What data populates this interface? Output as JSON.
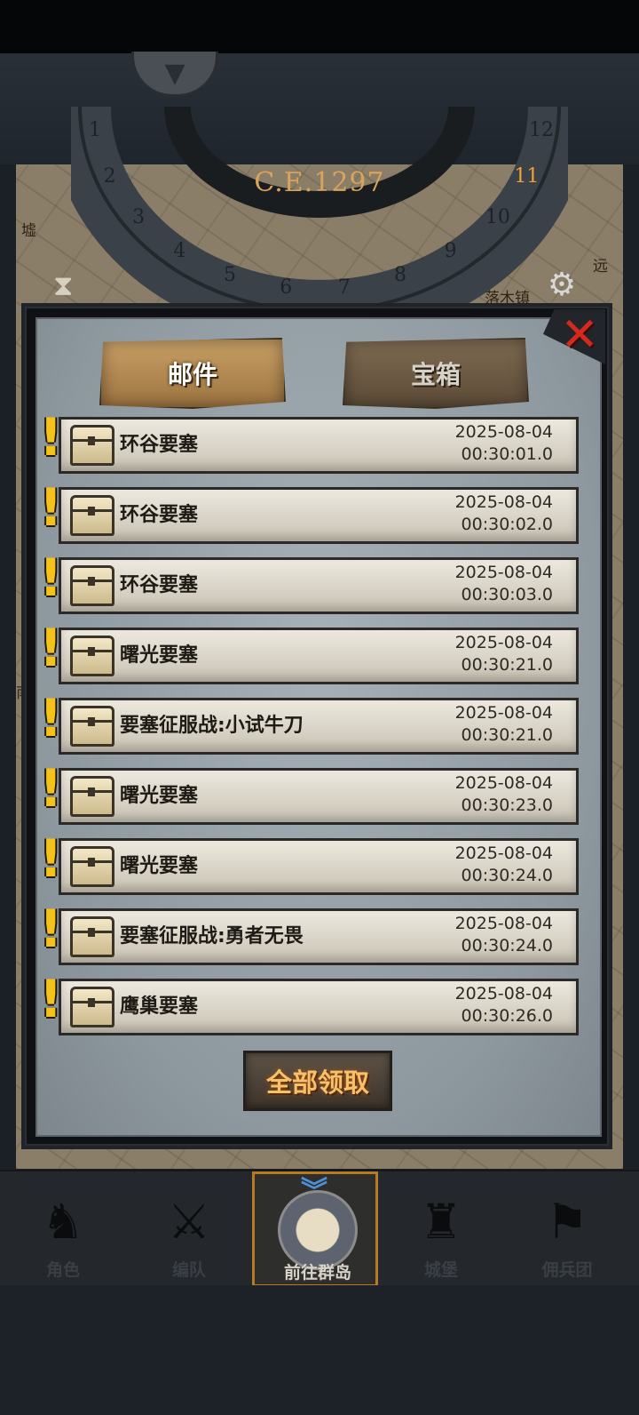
{
  "hud": {
    "era": "C.E.1297"
  },
  "map": {
    "labels": [
      "墟",
      "远",
      "落木镇",
      "南"
    ],
    "ring_numbers": [
      "1",
      "2",
      "3",
      "4",
      "5",
      "6",
      "7",
      "8",
      "9",
      "10",
      "11",
      "12"
    ],
    "highlight_number": "11"
  },
  "tabs": {
    "mail": "邮件",
    "chest": "宝箱",
    "active": "mail"
  },
  "mails": [
    {
      "title": "环谷要塞",
      "date": "2025-08-04",
      "time": "00:30:01.0"
    },
    {
      "title": "环谷要塞",
      "date": "2025-08-04",
      "time": "00:30:02.0"
    },
    {
      "title": "环谷要塞",
      "date": "2025-08-04",
      "time": "00:30:03.0"
    },
    {
      "title": "曙光要塞",
      "date": "2025-08-04",
      "time": "00:30:21.0"
    },
    {
      "title": "要塞征服战:小试牛刀",
      "date": "2025-08-04",
      "time": "00:30:21.0"
    },
    {
      "title": "曙光要塞",
      "date": "2025-08-04",
      "time": "00:30:23.0"
    },
    {
      "title": "曙光要塞",
      "date": "2025-08-04",
      "time": "00:30:24.0"
    },
    {
      "title": "要塞征服战:勇者无畏",
      "date": "2025-08-04",
      "time": "00:30:24.0"
    },
    {
      "title": "鹰巢要塞",
      "date": "2025-08-04",
      "time": "00:30:26.0"
    }
  ],
  "claim_all": "全部领取",
  "nav": [
    {
      "label": "角色",
      "icon": "knight-icon"
    },
    {
      "label": "编队",
      "icon": "squad-icon"
    },
    {
      "label": "前往群岛",
      "icon": "globe-icon",
      "active": true
    },
    {
      "label": "城堡",
      "icon": "castle-icon"
    },
    {
      "label": "佣兵团",
      "icon": "mercenary-icon"
    }
  ],
  "colors": {
    "accent_gold": "#d9a45a",
    "alert": "#f4c21a",
    "close": "#d22a1f",
    "nav_active_border": "#b77a22"
  }
}
